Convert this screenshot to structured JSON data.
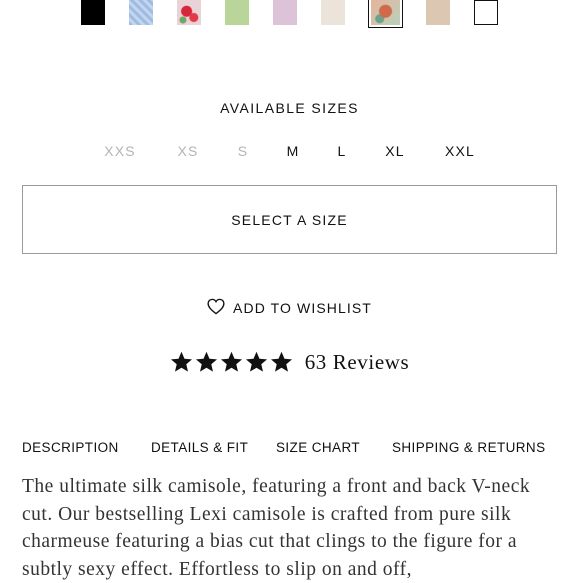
{
  "colors": {
    "text": "#111111",
    "muted_size": "#b4b4b4",
    "border": "#9a9a9a",
    "description_text": "#333333"
  },
  "swatches": [
    {
      "name": "black",
      "color": "#000000",
      "selected": false
    },
    {
      "name": "blue-pattern",
      "color": "#a7c3e4",
      "selected": false
    },
    {
      "name": "red-floral",
      "color": "#e8c9cf",
      "selected": false
    },
    {
      "name": "sage-green",
      "color": "#b9d59a",
      "selected": false
    },
    {
      "name": "lilac",
      "color": "#dcc3d7",
      "selected": false
    },
    {
      "name": "ivory",
      "color": "#ece3db",
      "selected": false
    },
    {
      "name": "painted-floral",
      "color": "#c88b6c",
      "selected": true
    },
    {
      "name": "nude",
      "color": "#dcc8b2",
      "selected": false
    },
    {
      "name": "white",
      "color": "#ffffff",
      "selected": false
    }
  ],
  "sizes": {
    "title": "AVAILABLE SIZES",
    "options": [
      {
        "label": "XXS",
        "available": false
      },
      {
        "label": "XS",
        "available": false
      },
      {
        "label": "S",
        "available": false
      },
      {
        "label": "M",
        "available": true
      },
      {
        "label": "L",
        "available": true
      },
      {
        "label": "XL",
        "available": true
      },
      {
        "label": "XXL",
        "available": true
      }
    ],
    "select_label": "SELECT A SIZE"
  },
  "wishlist": {
    "label": "ADD TO WISHLIST",
    "icon": "heart-icon"
  },
  "reviews": {
    "rating": 5,
    "max": 5,
    "count_label": "63 Reviews",
    "icon": "star-icon"
  },
  "tabs": [
    "DESCRIPTION",
    "DETAILS & FIT",
    "SIZE CHART",
    "SHIPPING & RETURNS"
  ],
  "description": "The ultimate silk camisole, featuring a front and back V-neck cut. Our bestselling Lexi camisole is crafted from pure silk charmeuse featuring a bias cut that clings to the figure for a subtly sexy effect. Effortless to slip on and off,"
}
